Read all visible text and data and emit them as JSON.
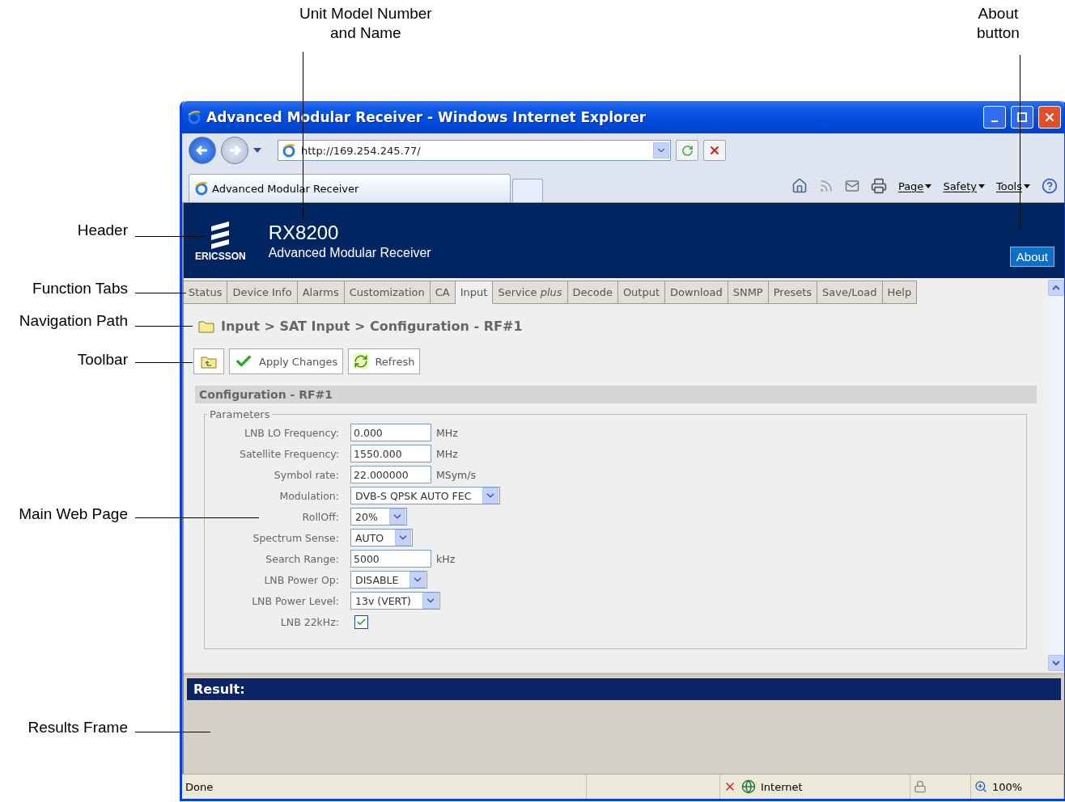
{
  "callouts": [
    {
      "lines": [
        "Unit Model Number",
        "and Name"
      ]
    },
    {
      "lines": [
        "About",
        "button"
      ]
    },
    {
      "lines": [
        "Header"
      ]
    },
    {
      "lines": [
        "Function Tabs"
      ]
    },
    {
      "lines": [
        "Navigation Path"
      ]
    },
    {
      "lines": [
        "Toolbar"
      ]
    },
    {
      "lines": [
        "Main Web Page"
      ]
    },
    {
      "lines": [
        "Results Frame"
      ]
    }
  ],
  "window": {
    "title": "Advanced Modular Receiver - Windows Internet Explorer",
    "address": "http://169.254.245.77/",
    "tab": "Advanced Modular Receiver",
    "commands": [
      "Page",
      "Safety",
      "Tools"
    ]
  },
  "header": {
    "logo": "ERICSSON",
    "model": "RX8200",
    "name": "Advanced Modular Receiver",
    "about": "About"
  },
  "tabs": [
    {
      "label": "Status",
      "selected": false
    },
    {
      "label": "Device Info",
      "selected": false
    },
    {
      "label": "Alarms",
      "selected": false
    },
    {
      "label": "Customization",
      "selected": false
    },
    {
      "label": "CA",
      "selected": false
    },
    {
      "label": "Input",
      "selected": true
    },
    {
      "label": "Service *plus*",
      "selected": false
    },
    {
      "label": "Decode",
      "selected": false
    },
    {
      "label": "Output",
      "selected": false
    },
    {
      "label": "Download",
      "selected": false
    },
    {
      "label": "SNMP",
      "selected": false
    },
    {
      "label": "Presets",
      "selected": false
    },
    {
      "label": "Save/Load",
      "selected": false
    },
    {
      "label": "Help",
      "selected": false
    }
  ],
  "navigation_path": "Input > SAT Input > Configuration - RF#1",
  "toolbar": [
    "Apply Changes",
    "Refresh"
  ],
  "section": {
    "title": "Configuration - RF#1",
    "legend": "Parameters"
  },
  "fields": [
    {
      "kind": "text",
      "label": "LNB LO Frequency:",
      "value": "0.000",
      "unit": "MHz"
    },
    {
      "kind": "text",
      "label": "Satellite Frequency:",
      "value": "1550.000",
      "unit": "MHz"
    },
    {
      "kind": "text",
      "label": "Symbol rate:",
      "value": "22.000000",
      "unit": "MSym/s"
    },
    {
      "kind": "select",
      "label": "Modulation:",
      "value": "DVB-S QPSK AUTO FEC"
    },
    {
      "kind": "select",
      "label": "RollOff:",
      "value": "20%"
    },
    {
      "kind": "select",
      "label": "Spectrum Sense:",
      "value": "AUTO"
    },
    {
      "kind": "text",
      "label": "Search Range:",
      "value": "5000",
      "unit": "kHz"
    },
    {
      "kind": "select",
      "label": "LNB Power Op:",
      "value": "DISABLE"
    },
    {
      "kind": "select",
      "label": "LNB Power Level:",
      "value": "13v (VERT)"
    },
    {
      "kind": "checkbox",
      "label": "LNB 22kHz:",
      "checked": true
    }
  ],
  "result": {
    "title": "Result:"
  },
  "status_bar": {
    "status": "Done",
    "zone": "Internet",
    "zoom": "100%"
  }
}
